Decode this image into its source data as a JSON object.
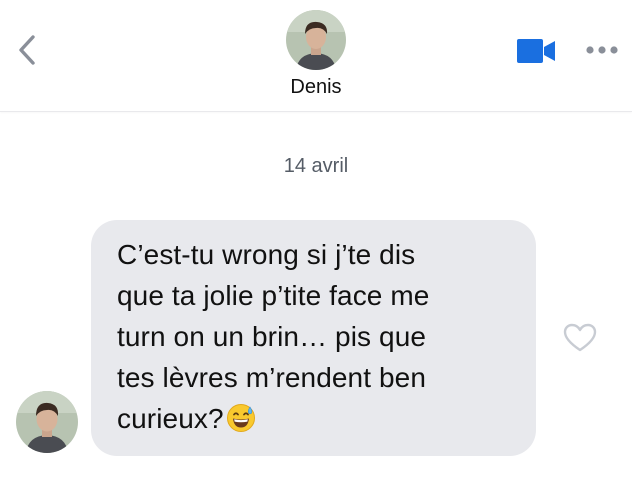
{
  "header": {
    "contact_name": "Denis",
    "icons": {
      "back": "chevron-left-icon",
      "video": "video-camera-icon",
      "more": "ellipsis-icon"
    }
  },
  "conversation": {
    "date_separator": "14 avril",
    "messages": [
      {
        "sender": "Denis",
        "lines": [
          "C’est-tu wrong si j’te dis",
          "que ta jolie p’tite face me",
          "turn on un brin… pis que",
          "tes lèvres m’rendent ben",
          "curieux?"
        ],
        "emoji": "grinning-face-with-sweat",
        "liked": false
      }
    ]
  },
  "colors": {
    "accent": "#1a6fe0",
    "bubble_background": "#e8e9ed",
    "icon_gray": "#8a8f99"
  }
}
